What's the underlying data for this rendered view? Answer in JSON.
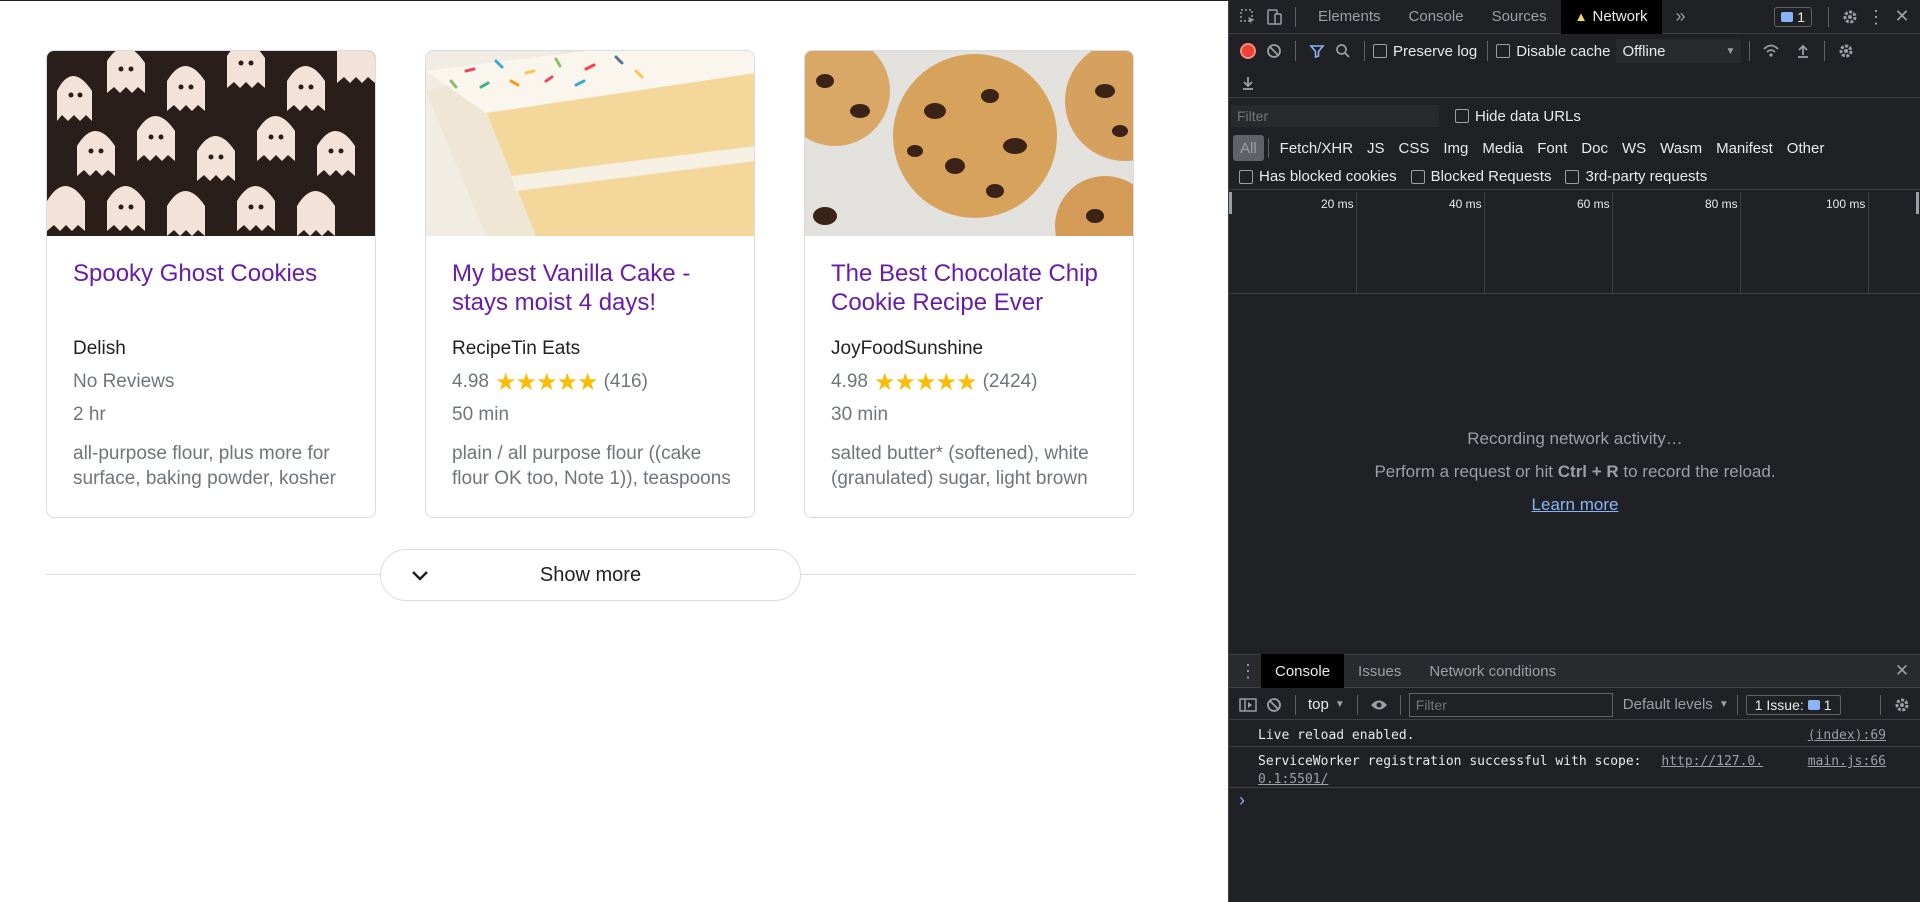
{
  "cards": [
    {
      "title": "Spooky Ghost Cookies",
      "source": "Delish",
      "rating_text": "No Reviews",
      "time": "2 hr",
      "ingredients": "all-purpose flour, plus more for surface, baking powder, kosher"
    },
    {
      "title": "My best Vanilla Cake - stays moist 4 days!",
      "source": "RecipeTin Eats",
      "rating": "4.98",
      "stars": "★★★★★",
      "reviews": "(416)",
      "time": "50 min",
      "ingredients": "plain / all purpose flour ((cake flour OK too, Note 1)), teaspoons"
    },
    {
      "title": "The Best Chocolate Chip Cookie Recipe Ever",
      "source": "JoyFoodSunshine",
      "rating": "4.98",
      "stars": "★★★★★",
      "reviews": "(2424)",
      "time": "30 min",
      "ingredients": "salted butter* (softened), white (granulated) sugar, light brown"
    }
  ],
  "show_more": "Show more",
  "devtools": {
    "tabs": [
      "Elements",
      "Console",
      "Sources",
      "Network"
    ],
    "more_tabs": "»",
    "issues_badge": "1",
    "preserve_log": "Preserve log",
    "disable_cache": "Disable cache",
    "throttle": "Offline",
    "filter_placeholder": "Filter",
    "hide_data_urls": "Hide data URLs",
    "types": [
      "All",
      "Fetch/XHR",
      "JS",
      "CSS",
      "Img",
      "Media",
      "Font",
      "Doc",
      "WS",
      "Wasm",
      "Manifest",
      "Other"
    ],
    "has_blocked_cookies": "Has blocked cookies",
    "blocked_requests": "Blocked Requests",
    "third_party": "3rd-party requests",
    "ticks": [
      "20 ms",
      "40 ms",
      "60 ms",
      "80 ms",
      "100 ms"
    ],
    "recording": "Recording network activity…",
    "perform_pre": "Perform a request or hit ",
    "perform_keys": "Ctrl + R",
    "perform_post": " to record the reload.",
    "learn_more": "Learn more",
    "drawer_tabs": [
      "Console",
      "Issues",
      "Network conditions"
    ],
    "context": "top",
    "console_filter": "Filter",
    "levels": "Default levels",
    "issue_label": "1 Issue:",
    "issue_count": "1",
    "messages": [
      {
        "text": "Live reload enabled.",
        "source": "(index):69"
      },
      {
        "text": "ServiceWorker registration successful with scope:",
        "link1": "http://127.0.",
        "link2": "0.1:5501/",
        "source": "main.js:66"
      }
    ],
    "prompt": "›"
  },
  "colors": {
    "title": "#681da8",
    "star": "#fbbc04",
    "recording": "#ea4335",
    "accent": "#8ab4f8"
  }
}
